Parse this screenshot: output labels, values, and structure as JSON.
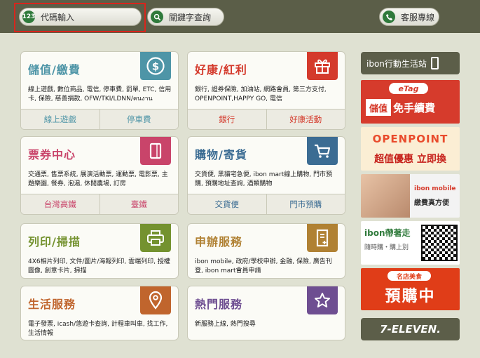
{
  "topbar": {
    "code_input_icon": "123",
    "code_input_label": "代碼輸入",
    "keyword_search_label": "關鍵字查詢",
    "customer_service_label": "客服專線"
  },
  "cards": {
    "topup": {
      "title": "儲值/繳費",
      "desc": "線上遊戲, 數位商品, 電信, 停車費, 罰單, ETC, 信用卡, 保險, 慈善捐款, OFW/TKI/LDNN/คนงาน",
      "btn1": "線上遊戲",
      "btn2": "停車費"
    },
    "deals": {
      "title": "好康/紅利",
      "desc": "銀行, 證券保險, 加油站, 網路會員, 第三方支付, OPENPOINT,HAPPY GO, 電信",
      "btn1": "銀行",
      "btn2": "好康活動"
    },
    "tickets": {
      "title": "票券中心",
      "desc": "交通票, 售票系統, 展演活動票, 運動票, 電影票, 主題樂園, 餐券, 泡湯, 休閒農場, 訂房",
      "btn1": "台灣高鐵",
      "btn2": "臺鐵"
    },
    "shopping": {
      "title": "購物/寄貨",
      "desc": "交貨便, 黑貓宅急便, ibon mart線上購物, 門市預購, 預購地址查詢, 酒類購物",
      "btn1": "交貨便",
      "btn2": "門市預購"
    },
    "print": {
      "title": "列印/掃描",
      "desc": "4X6相片列印, 文件/圖片/海報列印, 雲端列印, 授權圖像, 創意卡片, 掃描"
    },
    "apply": {
      "title": "申辦服務",
      "desc": "ibon mobile, 政府/學校申辦, 金融, 保險, 廣告刊登, ibon mart會員申請"
    },
    "life": {
      "title": "生活服務",
      "desc": "電子發票, icash/悠遊卡查詢, 計程車叫車, 找工作, 生活情報"
    },
    "hot": {
      "title": "熱門服務",
      "desc": "新服務上線, 熱門搜尋"
    }
  },
  "sidebar": {
    "ibon_station": "ibon行動生活站",
    "etag_logo": "eTag",
    "etag_text1": "儲值",
    "etag_text2": "免手續費",
    "op_logo": "OPENPOINT",
    "op_text": "超值優惠 立即換",
    "mobile_logo": "ibon mobile",
    "mobile_text": "繳費真方便",
    "qr_logo": "ibon帶著走",
    "qr_text": "隨時購・購上別",
    "pre_tag": "名店美食",
    "pre_text": "預購中",
    "seven_eleven": "7-ELEVEN."
  },
  "colors": {
    "topup": "#4e95a7",
    "deals": "#d43a2c",
    "tickets": "#c9446a",
    "shopping": "#3b6c93",
    "print": "#74922f",
    "apply": "#b08133",
    "life": "#c0652d",
    "hot": "#6e4e91",
    "topbar": "#5b5e48",
    "accent_green": "#2f7a3b"
  },
  "icons": {
    "topup": "dollar-icon",
    "deals": "gift-icon",
    "tickets": "ticket-icon",
    "shopping": "cart-icon",
    "print": "printer-icon",
    "apply": "form-icon",
    "life": "location-pin-icon",
    "hot": "star-icon"
  }
}
